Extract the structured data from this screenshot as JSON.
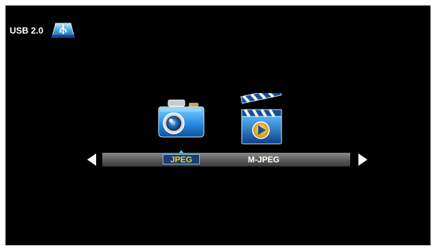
{
  "status": {
    "usb_label": "USB 2.0",
    "usb_icon": "usb-drive-icon"
  },
  "media_menu": {
    "items": [
      {
        "label": "JPEG",
        "icon": "camera-icon",
        "selected": true
      },
      {
        "label": "M-JPEG",
        "icon": "clapperboard-icon",
        "selected": false
      }
    ]
  },
  "colors": {
    "background": "#000000",
    "selected_text": "#ffd200",
    "selected_border": "#6cc6ff"
  }
}
